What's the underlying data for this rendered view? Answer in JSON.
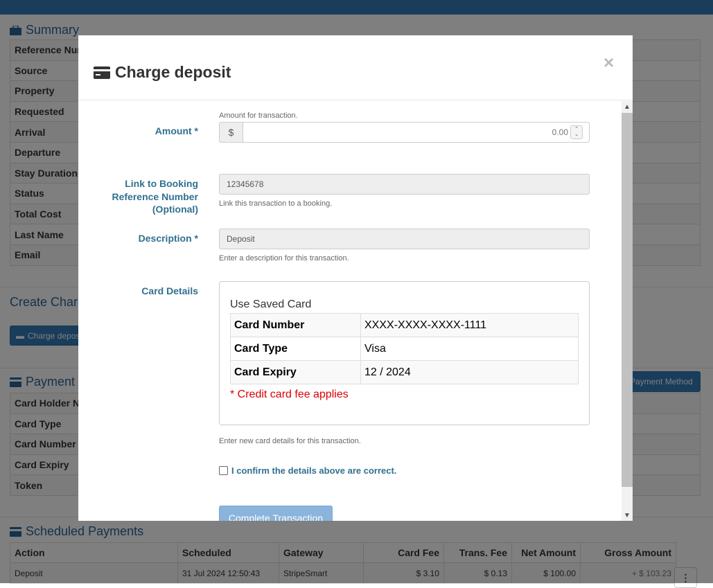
{
  "background": {
    "summary": {
      "title": "Summary",
      "rows": [
        "Reference Number",
        "Source",
        "Property",
        "Requested",
        "Arrival",
        "Departure",
        "Stay Duration",
        "Status",
        "Total Cost",
        "Last Name",
        "Email"
      ]
    },
    "create_charge": {
      "title": "Create Charge",
      "button": "Charge deposit"
    },
    "payment": {
      "title": "Payment",
      "rows": [
        "Card Holder Name",
        "Card Type",
        "Card Number",
        "Card Expiry",
        "Token"
      ],
      "button": "Payment Method"
    },
    "scheduled": {
      "title": "Scheduled Payments",
      "headers": [
        "Action",
        "Scheduled",
        "Gateway",
        "Card Fee",
        "Trans. Fee",
        "Net Amount",
        "Gross Amount"
      ],
      "row": [
        "Deposit",
        "31 Jul 2024 12:50:43",
        "StripeSmart",
        "$ 3.10",
        "$ 0.13",
        "$ 100.00",
        "+ $ 103.23"
      ],
      "menu_glyph": "⋮"
    }
  },
  "modal": {
    "title": "Charge deposit",
    "close": "×",
    "amount": {
      "label": "Amount *",
      "prefix": "$",
      "placeholder": "0.00",
      "help": "Amount for transaction."
    },
    "booking": {
      "label_line1": "Link to Booking",
      "label_line2": "Reference Number",
      "label_line3": "(Optional)",
      "value": "12345678",
      "help": "Link this transaction to a booking."
    },
    "description": {
      "label": "Description *",
      "value": "Deposit",
      "help": "Enter a description for this transaction."
    },
    "card": {
      "label": "Card Details",
      "heading": "Use Saved Card",
      "rows": [
        {
          "k": "Card Number",
          "v": "XXXX-XXXX-XXXX-1111"
        },
        {
          "k": "Card Type",
          "v": "Visa"
        },
        {
          "k": "Card Expiry",
          "v": "12 / 2024"
        }
      ],
      "fee_note": "* Credit card fee applies",
      "help": "Enter new card details for this transaction."
    },
    "confirm_label": "I confirm the details above are correct.",
    "submit": "Complete Transaction"
  }
}
